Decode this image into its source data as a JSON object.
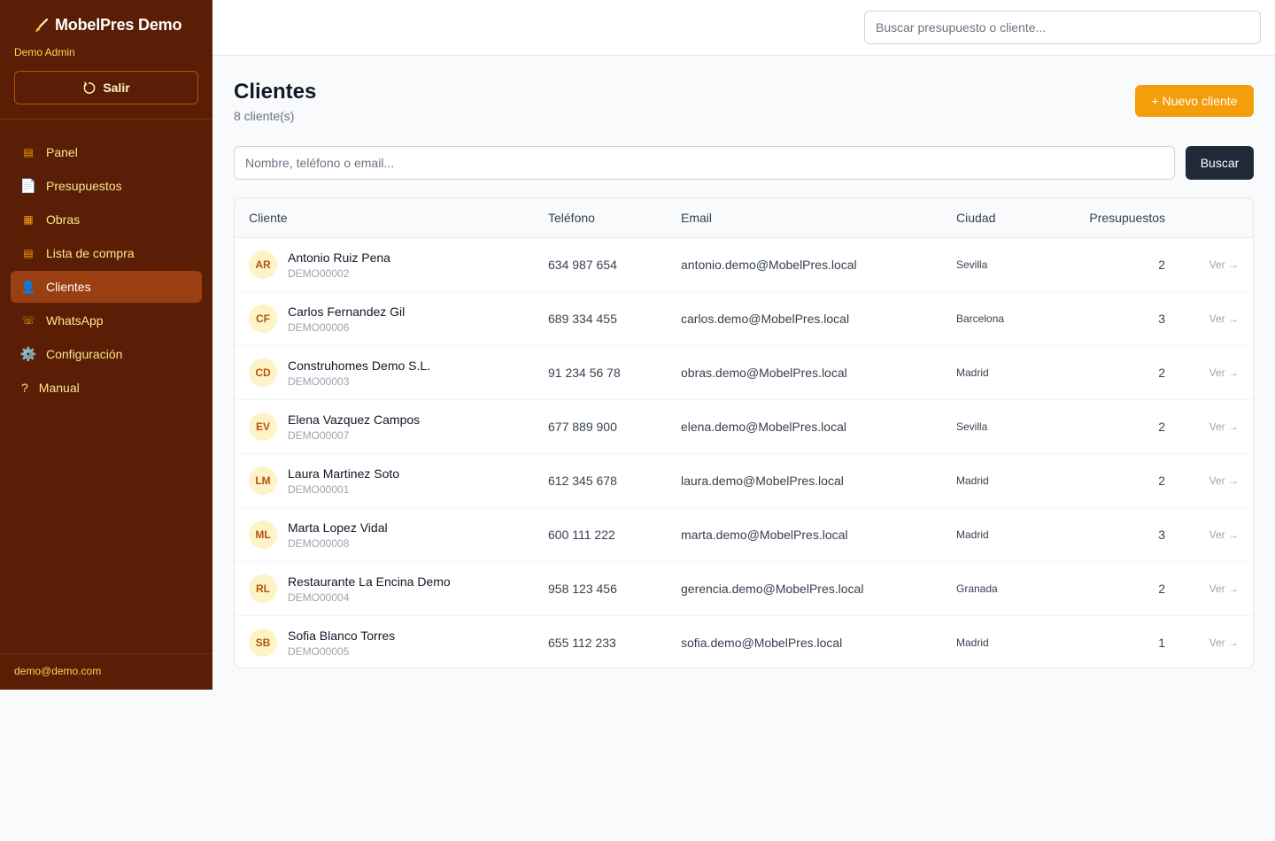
{
  "brand": {
    "name": "MobelPres Demo",
    "icon": "brush-icon"
  },
  "user": {
    "name": "Demo Admin",
    "logout_label": "Salir",
    "email": "demo@demo.com"
  },
  "nav": [
    {
      "label": "Panel",
      "icon": "▤",
      "active": false
    },
    {
      "label": "Presupuestos",
      "icon": "📄",
      "active": false
    },
    {
      "label": "Obras",
      "icon": "▦",
      "active": false
    },
    {
      "label": "Lista de compra",
      "icon": "▤",
      "active": false
    },
    {
      "label": "Clientes",
      "icon": "👤",
      "active": true
    },
    {
      "label": "WhatsApp",
      "icon": "☏",
      "active": false
    },
    {
      "label": "Configuración",
      "icon": "⚙️",
      "active": false
    },
    {
      "label": "Manual",
      "icon": "?",
      "active": false
    }
  ],
  "topbar": {
    "search_placeholder": "Buscar presupuesto o cliente..."
  },
  "page": {
    "title": "Clientes",
    "subtitle": "8 cliente(s)",
    "new_button": "+ Nuevo cliente",
    "filter_placeholder": "Nombre, teléfono o email...",
    "filter_button": "Buscar"
  },
  "table": {
    "headers": {
      "client": "Cliente",
      "phone": "Teléfono",
      "email": "Email",
      "city": "Ciudad",
      "quotes": "Presupuestos"
    },
    "view_label": "Ver →",
    "rows": [
      {
        "initials": "AR",
        "name": "Antonio Ruiz Pena",
        "code": "DEMO00002",
        "phone": "634 987 654",
        "email": "antonio.demo@MobelPres.local",
        "city": "Sevilla",
        "quotes": "2"
      },
      {
        "initials": "CF",
        "name": "Carlos Fernandez Gil",
        "code": "DEMO00006",
        "phone": "689 334 455",
        "email": "carlos.demo@MobelPres.local",
        "city": "Barcelona",
        "quotes": "3"
      },
      {
        "initials": "CD",
        "name": "Construhomes Demo S.L.",
        "code": "DEMO00003",
        "phone": "91 234 56 78",
        "email": "obras.demo@MobelPres.local",
        "city": "Madrid",
        "quotes": "2"
      },
      {
        "initials": "EV",
        "name": "Elena Vazquez Campos",
        "code": "DEMO00007",
        "phone": "677 889 900",
        "email": "elena.demo@MobelPres.local",
        "city": "Sevilla",
        "quotes": "2"
      },
      {
        "initials": "LM",
        "name": "Laura Martinez Soto",
        "code": "DEMO00001",
        "phone": "612 345 678",
        "email": "laura.demo@MobelPres.local",
        "city": "Madrid",
        "quotes": "2"
      },
      {
        "initials": "ML",
        "name": "Marta Lopez Vidal",
        "code": "DEMO00008",
        "phone": "600 111 222",
        "email": "marta.demo@MobelPres.local",
        "city": "Madrid",
        "quotes": "3"
      },
      {
        "initials": "RL",
        "name": "Restaurante La Encina Demo",
        "code": "DEMO00004",
        "phone": "958 123 456",
        "email": "gerencia.demo@MobelPres.local",
        "city": "Granada",
        "quotes": "2"
      },
      {
        "initials": "SB",
        "name": "Sofia Blanco Torres",
        "code": "DEMO00005",
        "phone": "655 112 233",
        "email": "sofia.demo@MobelPres.local",
        "city": "Madrid",
        "quotes": "1"
      }
    ]
  }
}
